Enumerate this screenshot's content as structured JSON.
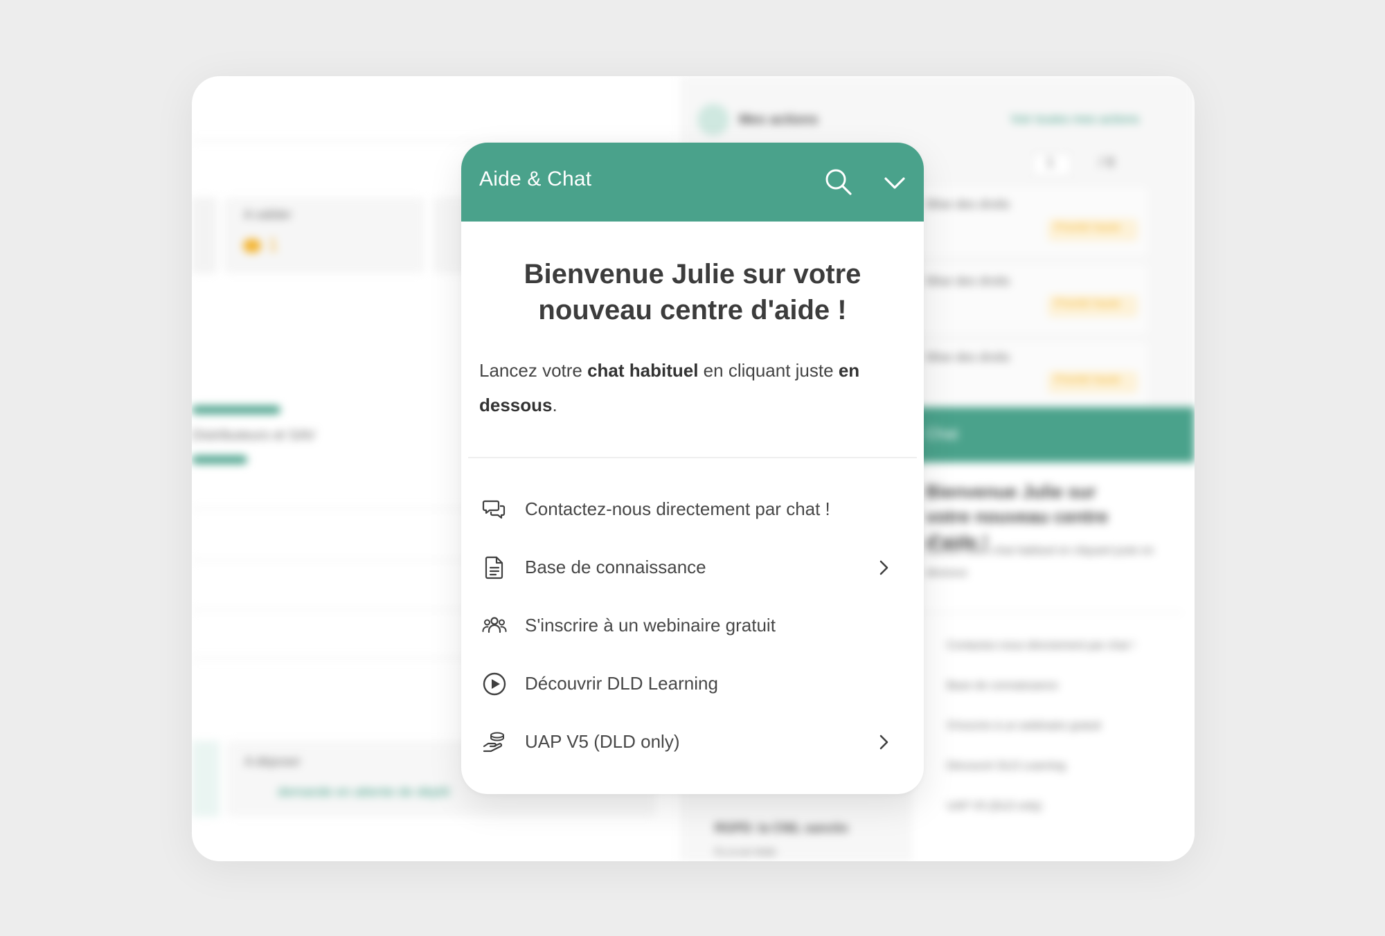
{
  "widget": {
    "title": "Aide & Chat",
    "welcome_line1": "Bienvenue Julie sur votre",
    "welcome_line2": "nouveau centre d'aide !",
    "intro": {
      "part1": "Lancez votre ",
      "bold1": "chat habituel",
      "part2": " en cliquant juste ",
      "bold2": "en dessous",
      "part3": "."
    },
    "menu": [
      {
        "label": "Contactez-nous directement par chat !",
        "icon": "chat-bubbles-icon",
        "has_arrow": false
      },
      {
        "label": "Base de connaissance",
        "icon": "document-icon",
        "has_arrow": true
      },
      {
        "label": "S'inscrire à un webinaire gratuit",
        "icon": "group-icon",
        "has_arrow": false
      },
      {
        "label": "Découvrir DLD Learning",
        "icon": "play-circle-icon",
        "has_arrow": false
      },
      {
        "label": "UAP V5 (DLD only)",
        "icon": "hand-coins-icon",
        "has_arrow": true
      }
    ]
  },
  "colors": {
    "accent": "#4aa28b",
    "background": "#ededed",
    "text": "#474747",
    "warning": "#f4b533"
  },
  "background_app": {
    "actions_title": "Mes actions",
    "actions_link": "Voir toutes mes actions",
    "pagination": {
      "current": "1",
      "total": "/ 8"
    },
    "stat_label": "A valider",
    "stat_value": "1",
    "row_label": "Distributeurs et SAV",
    "action_item": "Mise des droits",
    "action_badge": "Priorité haute",
    "deposit_label": "A déposer",
    "deposit_text": "demande en attente de dépôt",
    "bottom_item": "RGPD: la CNIL sanctio",
    "bottom_meta": "Il y a un mois",
    "chat_title": "Chat",
    "chat_welcome": "Bienvenue Julie sur votre nouveau centre d'aide !",
    "chat_intro": "Lancez votre chat habituel en cliquant juste en dessous",
    "chat_items": [
      "Contactez-nous directement par chat !",
      "Base de connaissance",
      "S'inscrire à un webinaire gratuit",
      "Découvrir DLD Learning",
      "UAP V5 (DLD only)"
    ]
  }
}
